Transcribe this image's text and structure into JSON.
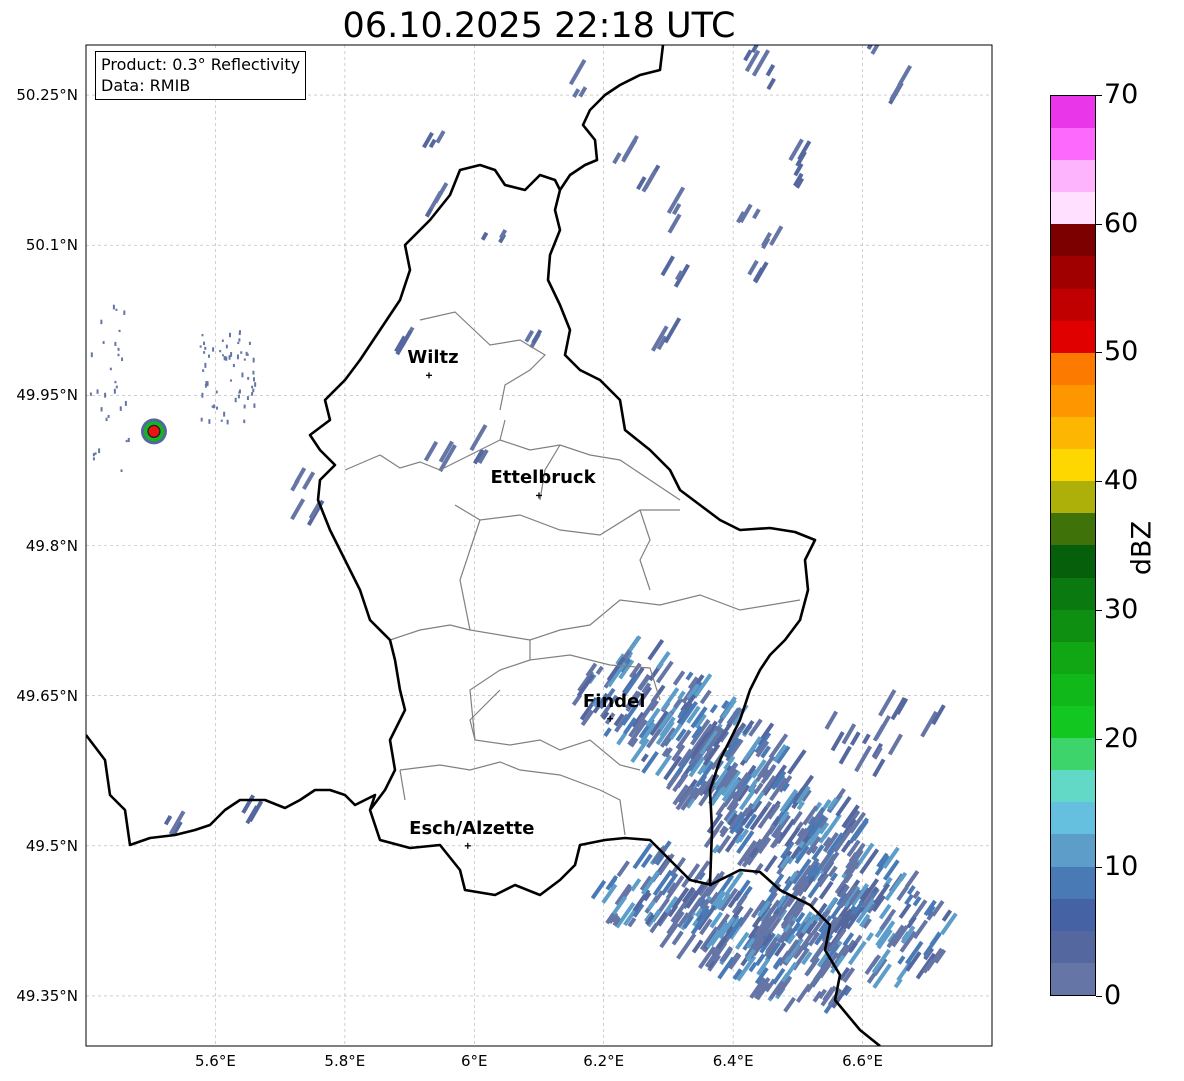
{
  "title": "06.10.2025 22:18 UTC",
  "info": {
    "product": "Product: 0.3° Reflectivity",
    "data": "Data: RMIB"
  },
  "y_ticks": [
    {
      "label": "50.25°N",
      "lat": 50.25
    },
    {
      "label": "50.1°N",
      "lat": 50.1
    },
    {
      "label": "49.95°N",
      "lat": 49.95
    },
    {
      "label": "49.8°N",
      "lat": 49.8
    },
    {
      "label": "49.65°N",
      "lat": 49.65
    },
    {
      "label": "49.5°N",
      "lat": 49.5
    },
    {
      "label": "49.35°N",
      "lat": 49.35
    }
  ],
  "x_ticks": [
    {
      "label": "5.6°E",
      "lon": 5.6
    },
    {
      "label": "5.8°E",
      "lon": 5.8
    },
    {
      "label": "6°E",
      "lon": 6.0
    },
    {
      "label": "6.2°E",
      "lon": 6.2
    },
    {
      "label": "6.4°E",
      "lon": 6.4
    },
    {
      "label": "6.6°E",
      "lon": 6.6
    }
  ],
  "extent": {
    "lon": [
      5.4,
      6.8
    ],
    "lat": [
      49.3,
      50.3
    ]
  },
  "cities": [
    {
      "name": "Wiltz",
      "lon": 5.93,
      "lat": 49.97
    },
    {
      "name": "Ettelbruck",
      "lon": 6.1,
      "lat": 49.85
    },
    {
      "name": "Findel",
      "lon": 6.21,
      "lat": 49.627
    },
    {
      "name": "Esch/Alzette",
      "lon": 5.99,
      "lat": 49.5
    }
  ],
  "radar_site": {
    "lon": 5.505,
    "lat": 49.914
  },
  "colorbar": {
    "unit": "dBZ",
    "range": [
      0,
      70
    ],
    "labels": [
      "0",
      "10",
      "20",
      "30",
      "40",
      "50",
      "60",
      "70"
    ],
    "colors": [
      "#6575a6",
      "#55679f",
      "#4562a4",
      "#4a7ab6",
      "#5c9ec9",
      "#64c0de",
      "#62d9c6",
      "#3dd46c",
      "#12c820",
      "#10b81a",
      "#10a614",
      "#0e8f12",
      "#0a7a10",
      "#065f0a",
      "#3f730a",
      "#aeb00a",
      "#fed600",
      "#fdb601",
      "#fe9600",
      "#fd7a00",
      "#e10000",
      "#c00000",
      "#a10000",
      "#7d0000",
      "#ffe1ff",
      "#fdb4fd",
      "#fd68fd",
      "#e936e9"
    ]
  }
}
